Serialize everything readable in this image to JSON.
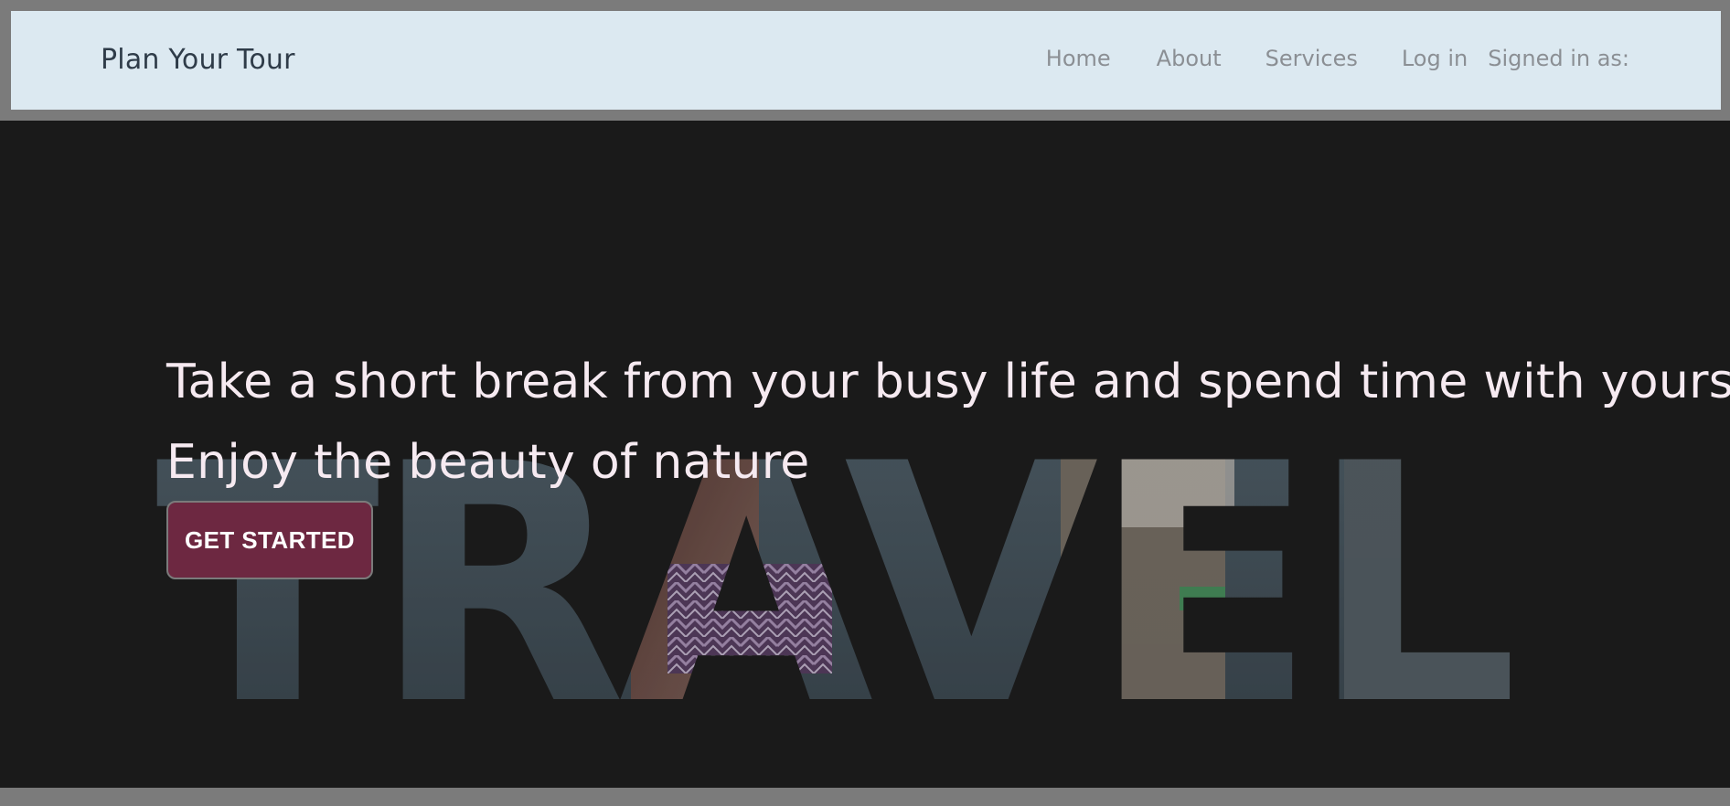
{
  "navbar": {
    "brand": "Plan Your Tour",
    "links": {
      "home": "Home",
      "about": "About",
      "services": "Services",
      "login": "Log in",
      "signed_in": "Signed in as:"
    }
  },
  "hero": {
    "headline": "Take a short break from your busy life and spend time with yourself",
    "subheadline": "Enjoy the beauty of nature",
    "cta_label": "GET STARTED",
    "background_word": "TRAVEL"
  },
  "colors": {
    "navbar_bg": "#dce9f1",
    "hero_bg": "#1b1b1b",
    "accent_button": "#6d2841",
    "text_light": "#f6eaf1"
  }
}
